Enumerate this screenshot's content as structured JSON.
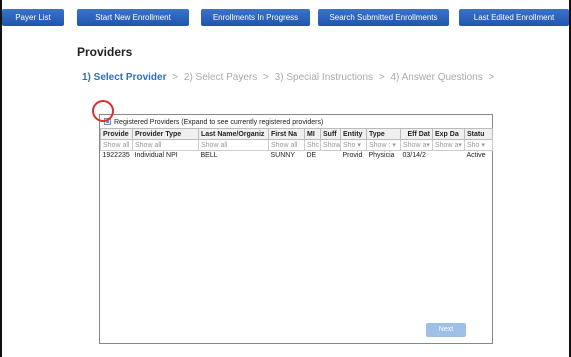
{
  "nav": {
    "buttons": [
      "Payer List",
      "Start New Enrollment",
      "Enrollments In Progress",
      "Search Submitted Enrollments",
      "Last Edited Enrollment"
    ]
  },
  "page": {
    "title": "Providers"
  },
  "steps": {
    "step1": "1) Select Provider",
    "step2": "2) Select Payers",
    "step3": "3) Special Instructions",
    "step4": "4) Answer Questions",
    "separator": ">"
  },
  "registered": {
    "label": "Registered Providers (Expand to see currently registered providers)"
  },
  "table": {
    "headers": [
      "Provide",
      "Provider Type",
      "Last Name/Organiz",
      "First Na",
      "MI",
      "Suff",
      "Entity",
      "Type",
      "Eff Dat",
      "Exp Da",
      "Statu"
    ],
    "filters": [
      "Show all",
      "Show all",
      "Show all",
      "Show all",
      "Shc",
      "Show",
      "Sho ▾",
      "Show : ▾",
      "Show a▾",
      "Show a▾",
      "Sho ▾"
    ],
    "rows": [
      [
        "1922235",
        "Individual NPI",
        "BELL",
        "SUNNY",
        "DE",
        "",
        "Provid",
        "Physicia",
        "03/14/2",
        "",
        "Active"
      ]
    ]
  },
  "actions": {
    "next_label": "Next"
  },
  "colors": {
    "nav_button": "#2a62bb",
    "active_step": "#2a6fbf",
    "highlight_circle": "#d9302b",
    "next_disabled": "#9fc0e6"
  }
}
